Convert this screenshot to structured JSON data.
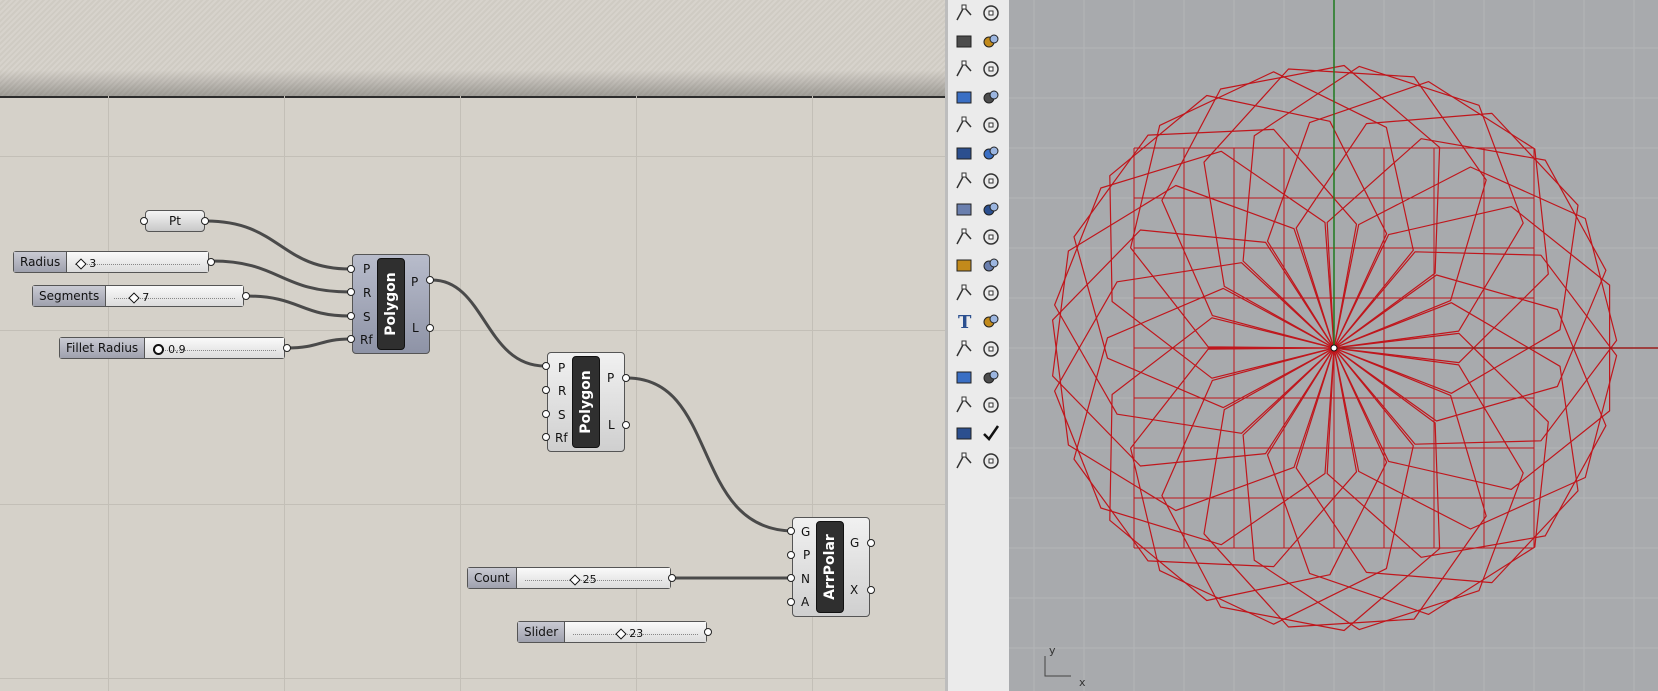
{
  "canvas": {
    "params": [
      {
        "name": "Pt"
      }
    ],
    "sliders": {
      "radius": {
        "label": "Radius",
        "value": "3"
      },
      "segments": {
        "label": "Segments",
        "value": "7"
      },
      "fillet": {
        "label": "Fillet Radius",
        "value": "0.9"
      },
      "count": {
        "label": "Count",
        "value": "25"
      },
      "slider": {
        "label": "Slider",
        "value": "23"
      }
    },
    "components": {
      "polygon1": {
        "name": "Polygon",
        "inputs": [
          "P",
          "R",
          "S",
          "Rf"
        ],
        "outputs": [
          "P",
          "L"
        ]
      },
      "polygon2": {
        "name": "Polygon",
        "inputs": [
          "P",
          "R",
          "S",
          "Rf"
        ],
        "outputs": [
          "P",
          "L"
        ]
      },
      "arrpolar": {
        "name": "ArrPolar",
        "inputs": [
          "G",
          "P",
          "N",
          "A"
        ],
        "outputs": [
          "G",
          "X"
        ]
      }
    }
  },
  "toolbar": {
    "tools": [
      "line-icon",
      "polyline-icon",
      "circle-icon",
      "ellipse-icon",
      "arc-icon",
      "rectangle-icon",
      "point-icon",
      "curve-icon",
      "surface-icon",
      "extrude-surface-icon",
      "box-icon",
      "sphere-icon",
      "cylinder-icon",
      "mesh-icon",
      "explode-icon",
      "trim-icon",
      "split-icon",
      "join-icon",
      "boolean-icon",
      "group-icon",
      "fillet-icon",
      "offset-icon",
      "text-icon",
      "dimension-icon",
      "transform-icon",
      "measure-icon",
      "block-icon",
      "plane-icon",
      "array-icon",
      "properties-icon",
      "render-icon",
      "check-icon",
      "shade-icon",
      "material-icon"
    ]
  },
  "viewport": {
    "axis_y": "y",
    "axis_x": "x",
    "colors": {
      "curves": "#c0161c",
      "background": "#a8aaad",
      "y_axis": "#1f7a1f",
      "x_axis": "#9a1c1c"
    },
    "polar_copies": 25,
    "polygon_segments": 7
  }
}
